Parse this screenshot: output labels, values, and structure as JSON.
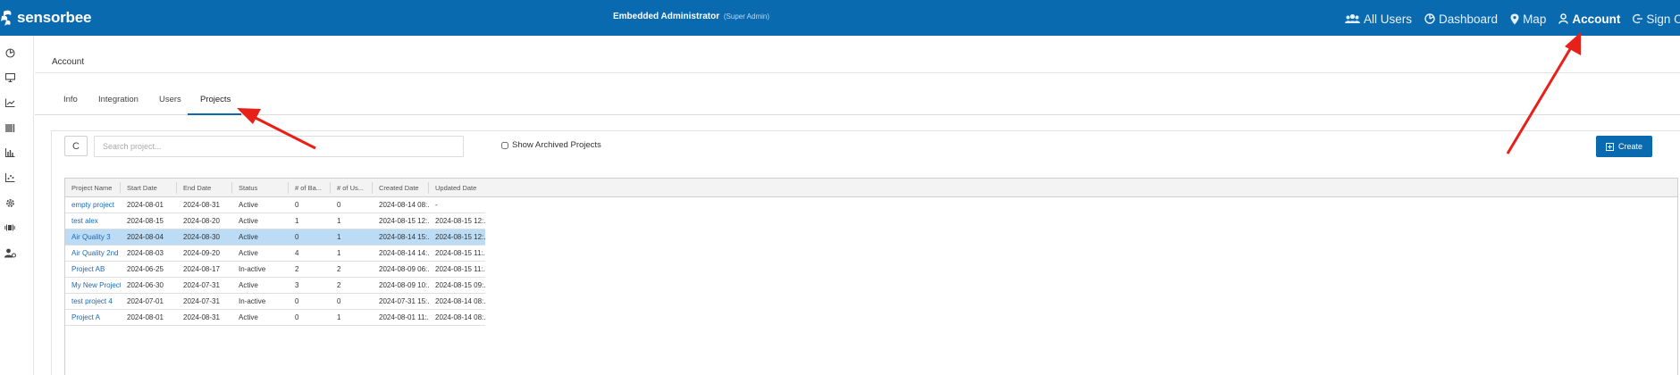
{
  "header": {
    "brand": "sensorbee",
    "admin_name": "Embedded Administrator",
    "admin_role": "(Super Admin)",
    "nav": [
      {
        "label": "All Users",
        "icon": "users-icon"
      },
      {
        "label": "Dashboard",
        "icon": "dashboard-icon"
      },
      {
        "label": "Map",
        "icon": "map-pin-icon"
      },
      {
        "label": "Account",
        "icon": "user-icon",
        "active": true
      },
      {
        "label": "Sign O",
        "icon": "sign-out-icon"
      }
    ],
    "bar_color": "#0a6ab0"
  },
  "sidebar": {
    "icons": [
      "dashboard-icon",
      "monitor-icon",
      "line-chart-icon",
      "barcode-icon",
      "bar-chart-icon",
      "scatter-chart-icon",
      "gear-icon",
      "sensor-icon",
      "user-settings-icon"
    ]
  },
  "breadcrumb": "Account",
  "tabs": [
    {
      "label": "Info"
    },
    {
      "label": "Integration"
    },
    {
      "label": "Users"
    },
    {
      "label": "Projects",
      "active": true
    }
  ],
  "toolbar": {
    "refresh_label": "C",
    "search_placeholder": "Search project...",
    "archived_label": "Show Archived Projects",
    "archived_checked": false,
    "create_label": "Create"
  },
  "table": {
    "columns": [
      "Project Name",
      "Start Date",
      "End Date",
      "Status",
      "# of Ba...",
      "# of Us...",
      "Created Date",
      "Updated Date"
    ],
    "rows": [
      {
        "name": "empty project",
        "start": "2024-08-01",
        "end": "2024-08-31",
        "status": "Active",
        "bases": "0",
        "users": "0",
        "created": "2024-08-14 08:...",
        "updated": "-"
      },
      {
        "name": "test alex",
        "start": "2024-08-15",
        "end": "2024-08-20",
        "status": "Active",
        "bases": "1",
        "users": "1",
        "created": "2024-08-15 12:...",
        "updated": "2024-08-15 12:..."
      },
      {
        "name": "Air Quality 3",
        "start": "2024-08-04",
        "end": "2024-08-30",
        "status": "Active",
        "bases": "0",
        "users": "1",
        "created": "2024-08-14 15:...",
        "updated": "2024-08-15 12:...",
        "selected": true
      },
      {
        "name": "Air Quality 2nd ...",
        "start": "2024-08-03",
        "end": "2024-09-20",
        "status": "Active",
        "bases": "4",
        "users": "1",
        "created": "2024-08-14 14:...",
        "updated": "2024-08-15 11:..."
      },
      {
        "name": "Project AB",
        "start": "2024-06-25",
        "end": "2024-08-17",
        "status": "In-active",
        "bases": "2",
        "users": "2",
        "created": "2024-08-09 06:...",
        "updated": "2024-08-15 11:..."
      },
      {
        "name": "My New Project",
        "start": "2024-06-30",
        "end": "2024-07-31",
        "status": "Active",
        "bases": "3",
        "users": "2",
        "created": "2024-08-09 10:...",
        "updated": "2024-08-15 09:..."
      },
      {
        "name": "test project 4",
        "start": "2024-07-01",
        "end": "2024-07-31",
        "status": "In-active",
        "bases": "0",
        "users": "0",
        "created": "2024-07-31 15:...",
        "updated": "2024-08-14 08:..."
      },
      {
        "name": "Project A",
        "start": "2024-08-01",
        "end": "2024-08-31",
        "status": "Active",
        "bases": "0",
        "users": "1",
        "created": "2024-08-01 11:...",
        "updated": "2024-08-14 08:..."
      }
    ]
  },
  "annotations": {
    "arrow_color": "#e8201a"
  }
}
